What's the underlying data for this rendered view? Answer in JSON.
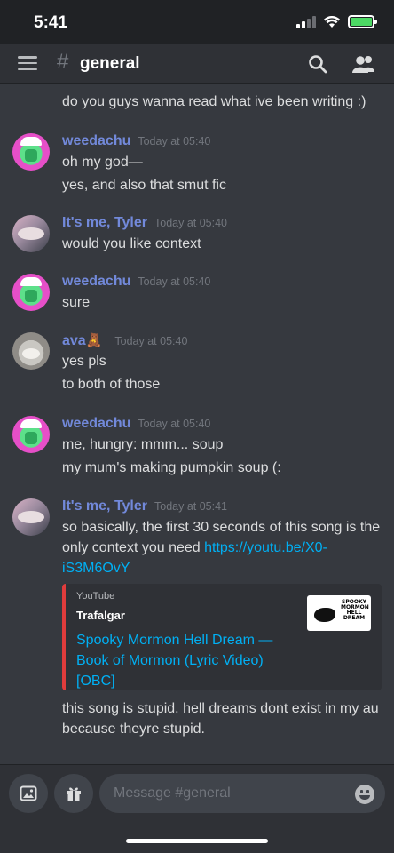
{
  "status_bar": {
    "time": "5:41"
  },
  "header": {
    "hash": "#",
    "channel": "general"
  },
  "messages": [
    {
      "lines": [
        "do you guys wanna read what ive been writing :)"
      ]
    },
    {
      "author": "weedachu",
      "timestamp": "Today at 05:40",
      "lines": [
        "oh my god—",
        "yes, and also that smut fic"
      ]
    },
    {
      "author": "It's me, Tyler",
      "timestamp": "Today at 05:40",
      "lines": [
        "would you like context"
      ]
    },
    {
      "author": "weedachu",
      "timestamp": "Today at 05:40",
      "lines": [
        "sure"
      ]
    },
    {
      "author": "ava",
      "author_emoji": "🧸",
      "timestamp": "Today at 05:40",
      "lines": [
        "yes pls",
        "to both of those"
      ]
    },
    {
      "author": "weedachu",
      "timestamp": "Today at 05:40",
      "lines": [
        "me, hungry: mmm... soup",
        "my mum's making pumpkin soup (:"
      ]
    },
    {
      "author": "It's me, Tyler",
      "timestamp": "Today at 05:41",
      "text_line1": "so basically, the first 30 seconds of this song is the",
      "text_line2_prefix": "only context you need ",
      "link_part1": "https://youtu.be/X0-",
      "link_part2": "iS3M6OvY",
      "embed": {
        "provider": "YouTube",
        "author": "Trafalgar",
        "title": "Spooky Mormon Hell Dream — Book of Mormon (Lyric Video) [OBC]",
        "thumbnail_text": "SPOOKY MORMON HELL DREAM"
      },
      "after_lines": [
        "this song is stupid. hell dreams dont exist in my au",
        "because theyre stupid."
      ]
    }
  ],
  "composer": {
    "placeholder": "Message #general"
  },
  "colors": {
    "accent": "#7289da",
    "link": "#00b0f4",
    "embed_border": "#e03c3c",
    "background": "#36393f"
  },
  "icons": [
    "menu-icon",
    "search-icon",
    "members-icon",
    "image-icon",
    "gift-icon",
    "emoji-icon"
  ]
}
